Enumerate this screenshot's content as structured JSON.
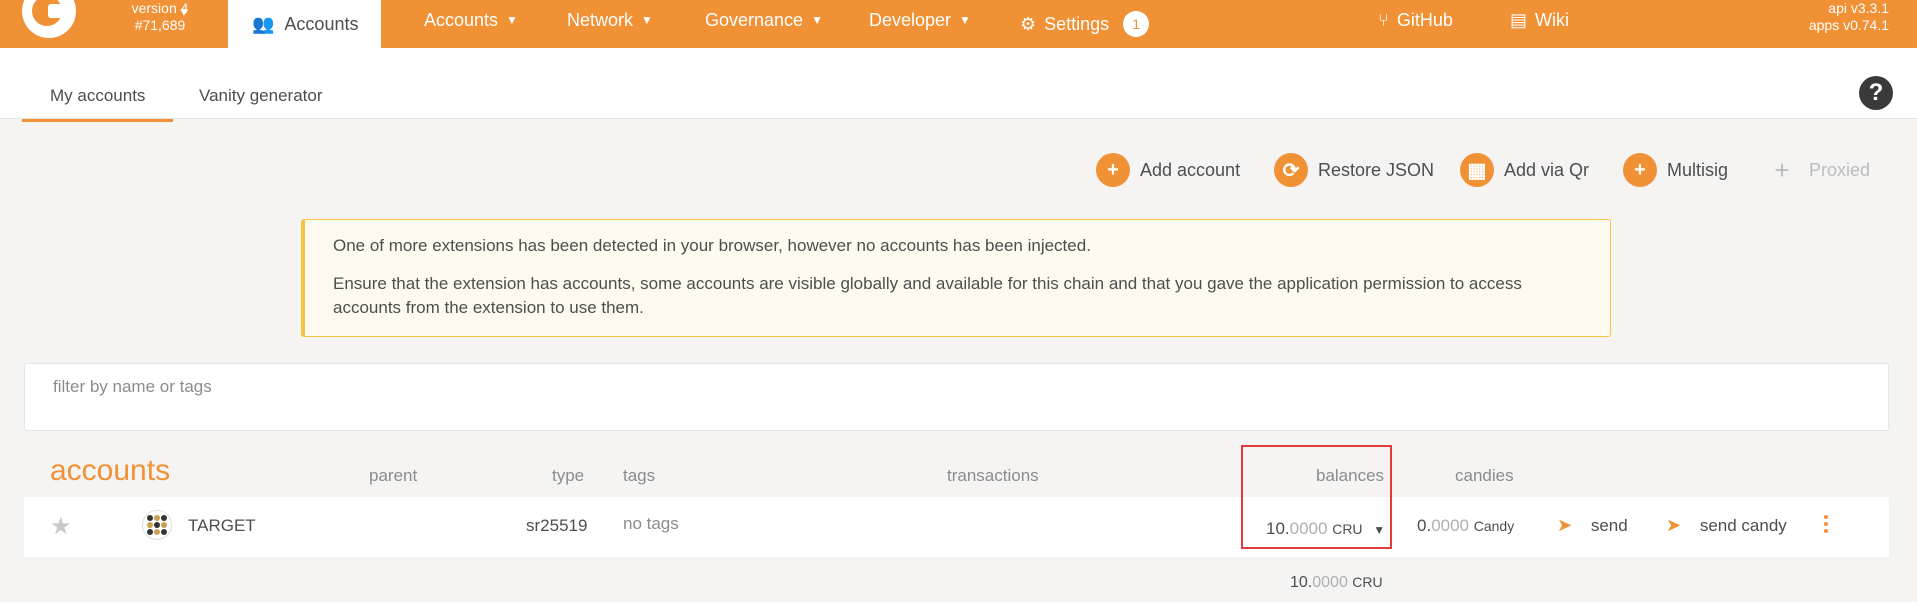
{
  "topbar": {
    "chain": {
      "version": "version 4",
      "block": "#71,689"
    },
    "active_tab": "Accounts",
    "menus": [
      "Accounts",
      "Network",
      "Governance",
      "Developer",
      "Settings"
    ],
    "settings_badge": "1",
    "links": [
      "GitHub",
      "Wiki"
    ],
    "api_version": "api v3.3.1",
    "apps_version": "apps v0.74.1"
  },
  "subtabs": [
    "My accounts",
    "Vanity generator"
  ],
  "help_label": "?",
  "actions": [
    "Add account",
    "Restore JSON",
    "Add via Qr",
    "Multisig",
    "Proxied"
  ],
  "warning": {
    "line1": "One of more extensions has been detected in your browser, however no accounts has been injected.",
    "line2": "Ensure that the extension has accounts, some accounts are visible globally and available for this chain and that you gave the application permission to access accounts from the extension to use them."
  },
  "filter": {
    "placeholder": "filter by name or tags"
  },
  "table": {
    "title": "accounts",
    "headers": [
      "parent",
      "type",
      "tags",
      "transactions",
      "balances",
      "candies"
    ],
    "rows": [
      {
        "name": "TARGET",
        "type": "sr25519",
        "tags": "no tags",
        "balance_int": "10.",
        "balance_dec": "0000",
        "balance_unit": "CRU",
        "candy_int": "0.",
        "candy_dec": "0000",
        "candy_unit": "Candy",
        "send": "send",
        "send_candy": "send candy"
      }
    ],
    "total": {
      "int": "10.",
      "dec": "0000",
      "unit": "CRU"
    }
  },
  "colors": {
    "accent": "#f19135",
    "highlight": "#e23b3b"
  }
}
